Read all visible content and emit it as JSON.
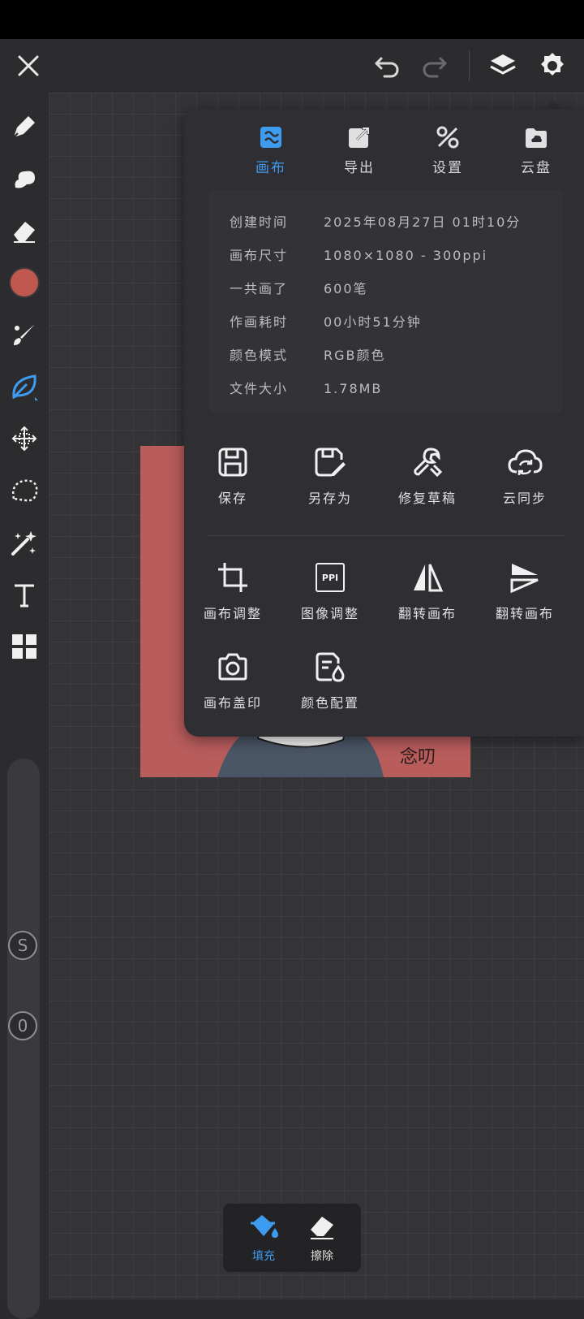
{
  "colors": {
    "accent": "#3d9bf0",
    "current_color": "#c0584f",
    "artwork_bg": "#b85c5c"
  },
  "toolbar": {
    "icons": [
      "close-icon",
      "undo-icon",
      "redo-icon",
      "layers-icon",
      "settings-icon"
    ]
  },
  "sidebar": {
    "tools": [
      "pen-icon",
      "smudge-icon",
      "eraser-icon",
      "color-swatch",
      "brush-icon",
      "leaf-brush-icon",
      "move-icon",
      "lasso-icon",
      "magic-wand-icon",
      "text-icon",
      "grid-icon"
    ],
    "size_knob": "S",
    "opacity_knob": "0"
  },
  "artwork": {
    "text": "念叨"
  },
  "panel": {
    "tabs": [
      {
        "label": "画布",
        "active": true
      },
      {
        "label": "导出",
        "active": false
      },
      {
        "label": "设置",
        "active": false
      },
      {
        "label": "云盘",
        "active": false
      }
    ],
    "info": [
      {
        "key": "创建时间",
        "value": "2025年08月27日 01时10分"
      },
      {
        "key": "画布尺寸",
        "value": "1080×1080 - 300ppi"
      },
      {
        "key": "一共画了",
        "value": "600笔"
      },
      {
        "key": "作画耗时",
        "value": "00小时51分钟"
      },
      {
        "key": "颜色模式",
        "value": "RGB颜色"
      },
      {
        "key": "文件大小",
        "value": "1.78MB"
      }
    ],
    "actions_row1": [
      {
        "label": "保存",
        "icon": "save-icon"
      },
      {
        "label": "另存为",
        "icon": "save-as-icon"
      },
      {
        "label": "修复草稿",
        "icon": "wrench-icon"
      },
      {
        "label": "云同步",
        "icon": "cloud-sync-icon"
      }
    ],
    "actions_row2": [
      {
        "label": "画布调整",
        "icon": "crop-icon"
      },
      {
        "label": "图像调整",
        "icon": "ppi-icon"
      },
      {
        "label": "翻转画布",
        "icon": "flip-horizontal-icon"
      },
      {
        "label": "翻转画布",
        "icon": "flip-vertical-icon"
      }
    ],
    "actions_row3": [
      {
        "label": "画布盖印",
        "icon": "camera-icon"
      },
      {
        "label": "颜色配置",
        "icon": "color-config-icon"
      }
    ],
    "ppi_icon_text": "PPI"
  },
  "bottom": {
    "fill_label": "填充",
    "clear_label": "擦除"
  }
}
